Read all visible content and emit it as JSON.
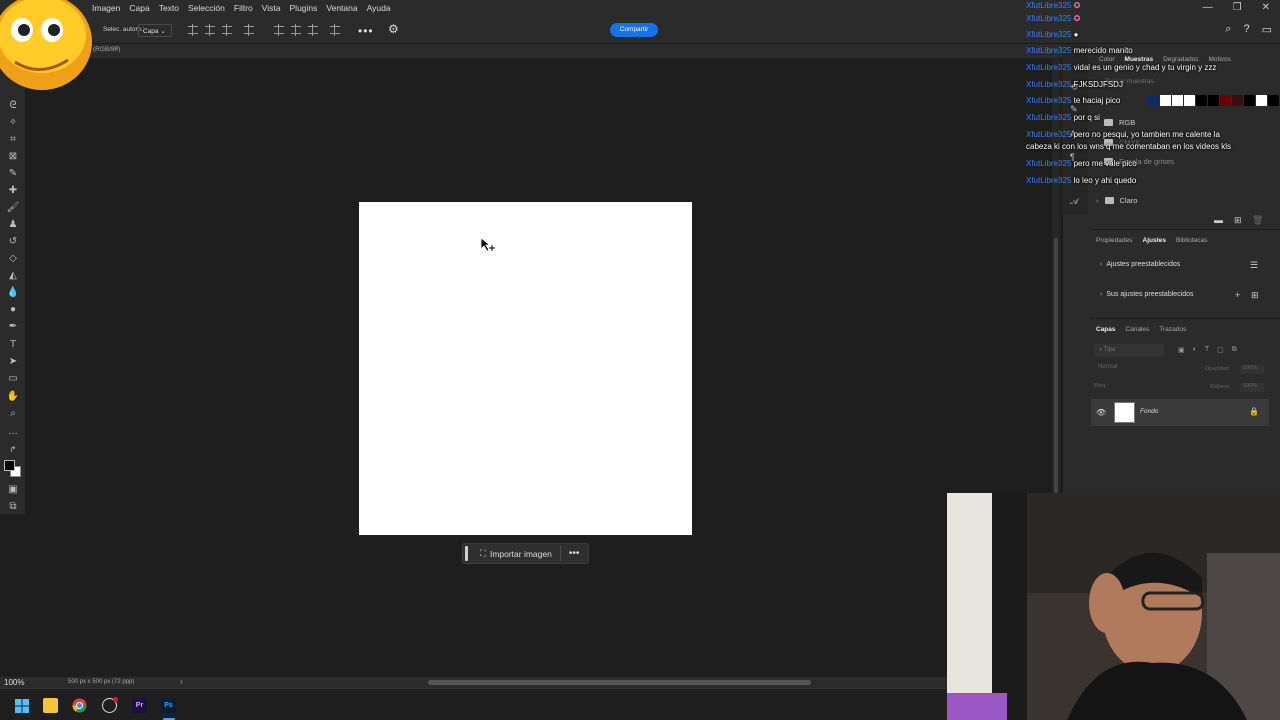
{
  "menu": {
    "items": [
      "Imagen",
      "Capa",
      "Texto",
      "Selección",
      "Filtro",
      "Vista",
      "Plugins",
      "Ventana",
      "Ayuda"
    ]
  },
  "options_bar": {
    "auto_select_label": "Selec. autom.:",
    "target_select": "Capa",
    "share_label": "Compartir"
  },
  "document_tab": {
    "label": "(RGB/8#)"
  },
  "canvas": {
    "contextual_task_bar": {
      "import_label": "Importar imagen"
    }
  },
  "status_bar": {
    "zoom": "100%",
    "doc_info": "500 px x 500 px (72 ppp)"
  },
  "right_panels": {
    "color_tabs": [
      "Color",
      "Muestras",
      "Degradados",
      "Motivos"
    ],
    "color_active": "Muestras",
    "search_placeholder": "Buscar muestras",
    "swatch_colors": [
      "#0f2a5c",
      "#ffffff",
      "#ffffff",
      "#ffffff",
      "#000000",
      "#000000",
      "#6b0000",
      "#3a0f0f",
      "#000000",
      "#1a1a1a",
      "#000000",
      "#8a8a8a",
      "#000000"
    ],
    "folders": [
      "RGB",
      "CMYK",
      "Escala de grises",
      "Claro"
    ],
    "adjust_tabs": [
      "Propiedades",
      "Ajustes",
      "Bibliotecas"
    ],
    "adjust_active": "Ajustes",
    "adjust_items": [
      "Ajustes preestablecidos",
      "Sus ajustes preestablecidos"
    ],
    "layers_tabs": [
      "Capas",
      "Canales",
      "Trazados"
    ],
    "layers_active": "Capas",
    "layers_search": "Tipo",
    "blend_mode": "Normal",
    "opacity_label": "Opacidad:",
    "opacity_value": "100%",
    "lock_label": "Bloq.:",
    "fill_label": "Relleno:",
    "fill_value": "100%",
    "layer_name": "Fondo"
  },
  "chat": [
    {
      "user": "XfutLibre325",
      "msg": ""
    },
    {
      "user": "XfutLibre325",
      "msg": ""
    },
    {
      "user": "XfutLibre325",
      "msg": ""
    },
    {
      "user": "XfutLibre325",
      "msg": "merecido manito"
    },
    {
      "user": "XfutLibre325",
      "msg": "vidal es un genio y chad y tu virgin y zzz"
    },
    {
      "user": "XfutLibre325",
      "msg": "FJKSDJFSDJ"
    },
    {
      "user": "XfutLibre325",
      "msg": "te haciaj pico"
    },
    {
      "user": "XfutLibre325",
      "msg": "por q si"
    },
    {
      "user": "XfutLibre325",
      "msg": "pero no pesqui, yo tambien me calente la"
    },
    {
      "user": "",
      "msg": "cabeza ki con los wns q me comentaban en los videos kls"
    },
    {
      "user": "XfutLibre325",
      "msg": "pero me vale pico"
    },
    {
      "user": "XfutLibre325",
      "msg": "lo leo y ahi quedo"
    }
  ],
  "taskbar": {
    "apps": [
      "windows-start",
      "file-explorer",
      "chrome",
      "obs",
      "Pr",
      "Ps"
    ]
  }
}
